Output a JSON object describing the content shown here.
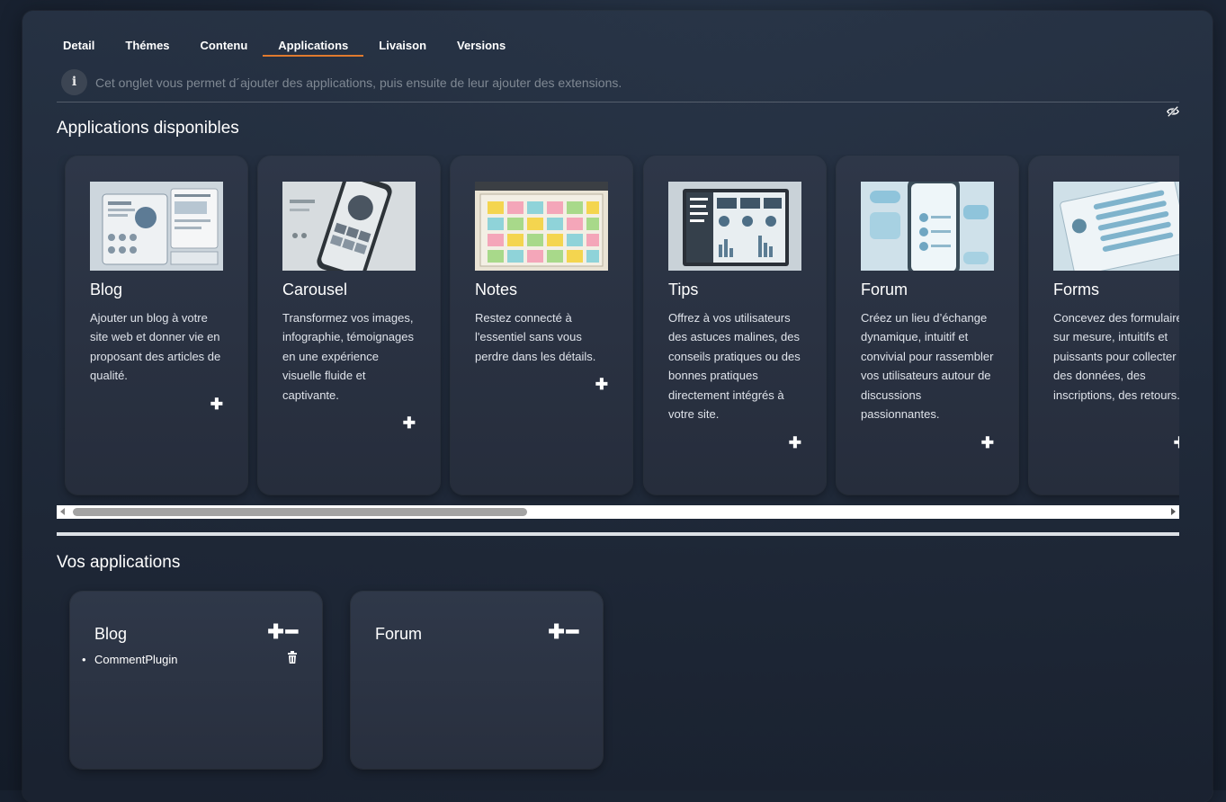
{
  "tabs": [
    {
      "label": "Detail"
    },
    {
      "label": "Thémes"
    },
    {
      "label": "Contenu"
    },
    {
      "label": "Applications",
      "active": true
    },
    {
      "label": "Livaison"
    },
    {
      "label": "Versions"
    }
  ],
  "info": {
    "icon": "info-icon",
    "text": "Cet onglet vous permet d´ajouter des applications, puis ensuite de leur ajouter des extensions."
  },
  "available": {
    "title": "Applications disponibles",
    "cards": [
      {
        "title": "Blog",
        "description": "Ajouter un blog à votre site web et donner vie en proposant des articles de qualité.",
        "add_label": "+"
      },
      {
        "title": "Carousel",
        "description": "Transformez vos images, infographie, témoignages en une expérience visuelle fluide et captivante.",
        "add_label": "+"
      },
      {
        "title": "Notes",
        "description": "Restez connecté à l'essentiel sans vous perdre dans les détails.",
        "add_label": "+"
      },
      {
        "title": "Tips",
        "description": "Offrez à vos utilisateurs des astuces malines, des conseils pratiques ou des bonnes pratiques directement intégrés à votre site.",
        "add_label": "+"
      },
      {
        "title": "Forum",
        "description": "Créez un lieu d’échange dynamique, intuitif et convivial pour rassembler vos utilisateurs autour de discussions passionnantes.",
        "add_label": "+"
      },
      {
        "title": "Forms",
        "description": "Concevez des formulaires sur mesure, intuitifs et puissants pour collecter des données, des inscriptions, des retours.",
        "add_label": "+"
      }
    ]
  },
  "mine": {
    "title": "Vos applications",
    "apps": [
      {
        "title": "Blog",
        "add_label": "+",
        "remove_label": "−",
        "plugins": [
          "CommentPlugin"
        ]
      },
      {
        "title": "Forum",
        "add_label": "+",
        "remove_label": "−",
        "plugins": []
      }
    ]
  },
  "colors": {
    "accent": "#e07a2e",
    "background": "#1c2636",
    "card": "#2e3748"
  }
}
